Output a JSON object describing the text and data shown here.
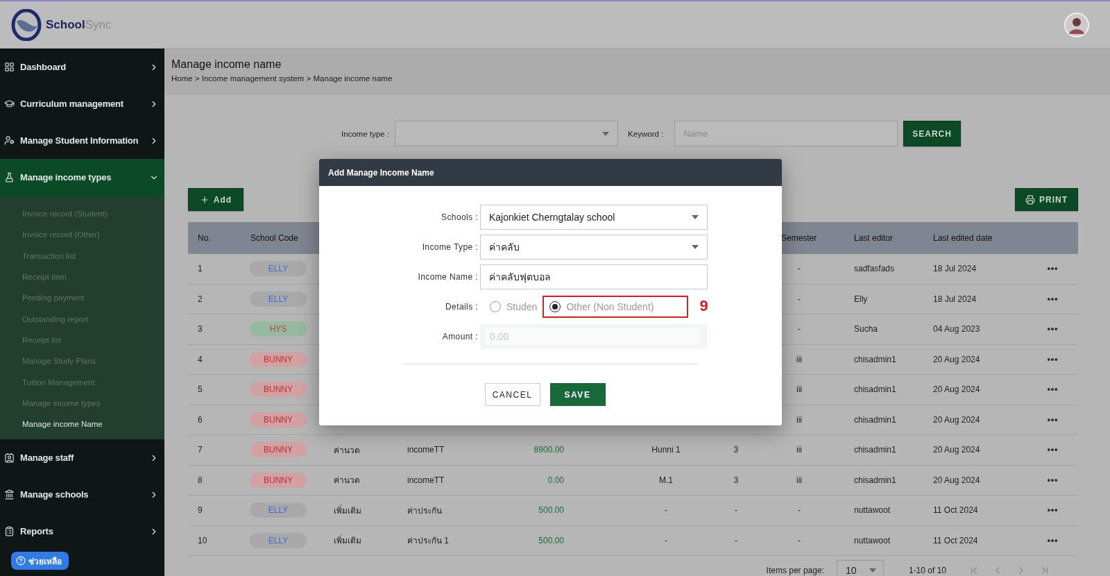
{
  "logo": {
    "primary": "School",
    "secondary": "Sync"
  },
  "sidebar": {
    "items": [
      {
        "label": "Dashboard",
        "expanded": false
      },
      {
        "label": "Curriculum management",
        "expanded": false
      },
      {
        "label": "Manage Student Information",
        "expanded": false
      },
      {
        "label": "Manage income types",
        "expanded": true,
        "children": [
          {
            "label": "Invoice record (Student)",
            "selected": false
          },
          {
            "label": "Invoice record (Other)",
            "selected": false
          },
          {
            "label": "Transaction list",
            "selected": false
          },
          {
            "label": "Receipt item",
            "selected": false
          },
          {
            "label": "Pending payment",
            "selected": false
          },
          {
            "label": "Outstanding report",
            "selected": false
          },
          {
            "label": "Receipt list",
            "selected": false
          },
          {
            "label": "Manage Study Plans",
            "selected": false
          },
          {
            "label": "Tuition Management",
            "selected": false
          },
          {
            "label": "Manage income types",
            "selected": false
          },
          {
            "label": "Manage income Name",
            "selected": true
          }
        ]
      },
      {
        "label": "Manage staff",
        "expanded": false
      },
      {
        "label": "Manage schools",
        "expanded": false
      },
      {
        "label": "Reports",
        "expanded": false
      }
    ],
    "help": "ช่วยเหลือ"
  },
  "page": {
    "title": "Manage income name",
    "breadcrumb": "Home > Income management system > Manage income name"
  },
  "filters": {
    "income_type_label": "Income type :",
    "keyword_label": "Keyword :",
    "keyword_placeholder": "Name",
    "search": "SEARCH"
  },
  "actions": {
    "add": "Add",
    "print": "PRINT"
  },
  "table": {
    "columns": {
      "no": "No.",
      "school_code": "School Code",
      "semester": "Semester",
      "last_editor": "Last editor",
      "last_edited_date": "Last edited date"
    },
    "rows": [
      {
        "no": "1",
        "school_code": {
          "label": "ELLY",
          "color": "#a9a9ab",
          "kind": "neutral"
        },
        "semester": "-",
        "last_editor": "sadfasfads",
        "last_edited_date": "18 Jul 2024"
      },
      {
        "no": "2",
        "school_code": {
          "label": "ELLY",
          "color": "#a9a9ab",
          "kind": "neutral"
        },
        "semester": "-",
        "last_editor": "Elly",
        "last_edited_date": "18 Jul 2024"
      },
      {
        "no": "3",
        "school_code": {
          "label": "HYS",
          "color": "#95b9a1",
          "kind": "success"
        },
        "semester": "-",
        "last_editor": "Sucha",
        "last_edited_date": "04 Aug 2023"
      },
      {
        "no": "4",
        "school_code": {
          "label": "BUNNY",
          "color": "#d2a1a4",
          "kind": "danger"
        },
        "semester": "iii",
        "last_editor": "chisadmin1",
        "last_edited_date": "20 Aug 2024"
      },
      {
        "no": "5",
        "school_code": {
          "label": "BUNNY",
          "color": "#d2a1a4",
          "kind": "danger"
        },
        "semester": "iii",
        "last_editor": "chisadmin1",
        "last_edited_date": "20 Aug 2024"
      },
      {
        "no": "6",
        "school_code": {
          "label": "BUNNY",
          "color": "#d2a1a4",
          "kind": "danger"
        },
        "semester": "iii",
        "last_editor": "chisadmin1",
        "last_edited_date": "20 Aug 2024"
      },
      {
        "no": "7",
        "school_code": {
          "label": "BUNNY",
          "color": "#d2a1a4",
          "kind": "danger"
        },
        "column_3": "ค่านวด",
        "column_4": "incomeTT",
        "column_5": "8900.00",
        "column_6": "Hunni 1",
        "column_7": "3",
        "semester": "iii",
        "last_editor": "chisadmin1",
        "last_edited_date": "20 Aug 2024"
      },
      {
        "no": "8",
        "school_code": {
          "label": "BUNNY",
          "color": "#d2a1a4",
          "kind": "danger"
        },
        "column_3": "ค่านวด",
        "column_4": "incomeTT",
        "column_5": "0.00",
        "column_6": "M.1",
        "column_7": "3",
        "semester": "iii",
        "last_editor": "chisadmin1",
        "last_edited_date": "20 Aug 2024"
      },
      {
        "no": "9",
        "school_code": {
          "label": "ELLY",
          "color": "#a9a9ab",
          "kind": "neutral"
        },
        "column_3": "เพิ่มเติม",
        "column_4": "ค่าประกัน",
        "column_5": "500.00",
        "column_6": "-",
        "column_7": "-",
        "semester": "-",
        "last_editor": "nuttawoot",
        "last_edited_date": "11 Oct 2024"
      },
      {
        "no": "10",
        "school_code": {
          "label": "ELLY",
          "color": "#a9a9ab",
          "kind": "neutral"
        },
        "column_3": "เพิ่มเติม",
        "column_4": "ค่าประกัน 1",
        "column_5": "500.00",
        "column_6": "-",
        "column_7": "-",
        "semester": "-",
        "last_editor": "nuttawoot",
        "last_edited_date": "11 Oct 2024"
      }
    ]
  },
  "pagination": {
    "label": "Items per page:",
    "page_size": "10",
    "range": "1-10 of 10"
  },
  "modal": {
    "title": "Add Manage Income Name",
    "fields": [
      {
        "kind": "select",
        "label": "Schools :",
        "value": "Kajonkiet Cherngtalay school"
      },
      {
        "kind": "select",
        "label": "Income Type :",
        "value": "ค่าคลับ"
      },
      {
        "kind": "text",
        "label": "Income Name :",
        "value": "ค่าคลับฟุตบอล"
      },
      {
        "kind": "radio",
        "label": "Details :",
        "options": [
          {
            "label": "Studen",
            "selected": false
          },
          {
            "label": "Other (Non Student)",
            "selected": true,
            "callout": "9"
          }
        ]
      },
      {
        "kind": "amount",
        "label": "Amount :",
        "placeholder": "0.00"
      }
    ],
    "cancel": "CANCEL",
    "save": "SAVE"
  }
}
